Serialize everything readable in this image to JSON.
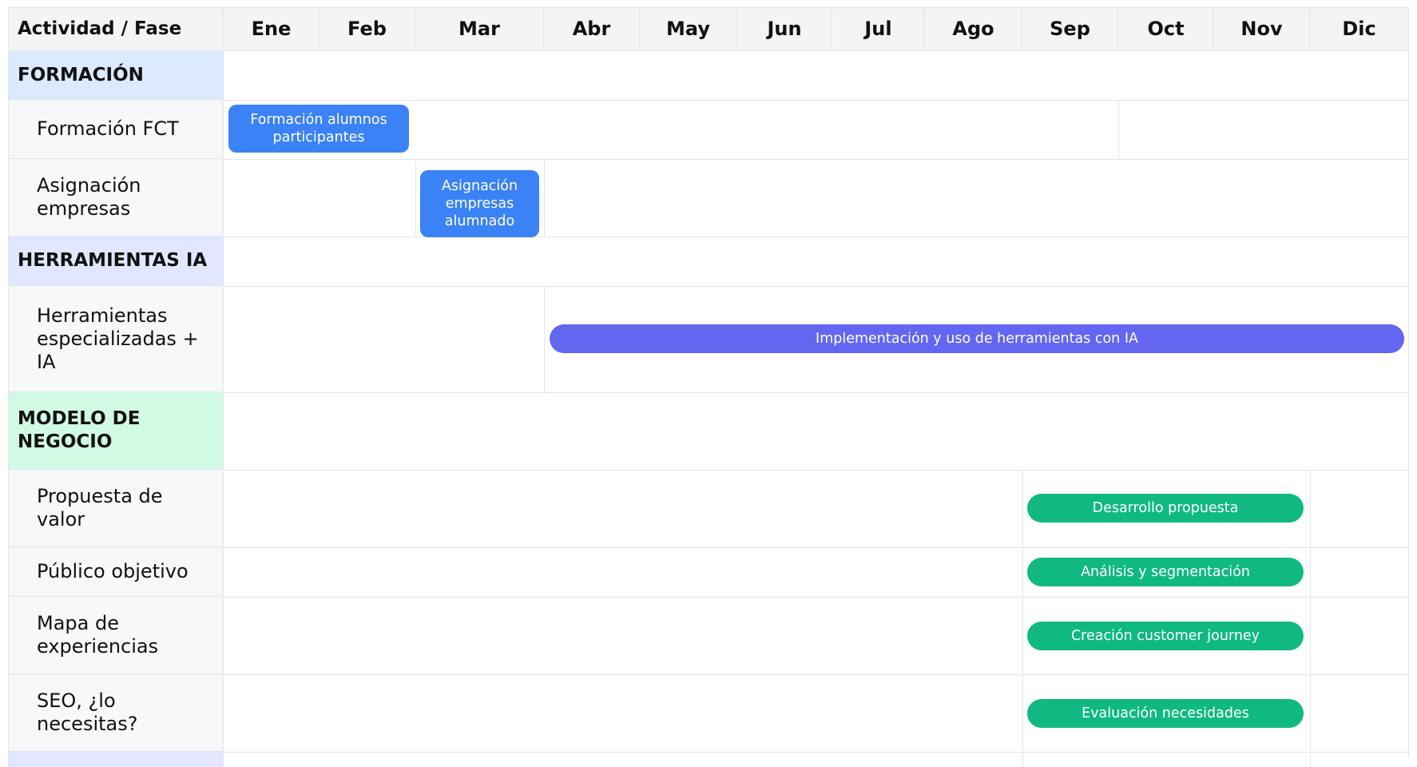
{
  "header": {
    "first_col": "Actividad / Fase",
    "months": [
      "Ene",
      "Feb",
      "Mar",
      "Abr",
      "May",
      "Jun",
      "Jul",
      "Ago",
      "Sep",
      "Oct",
      "Nov",
      "Dic"
    ]
  },
  "sections": {
    "formacion": {
      "label": "FORMACIÓN",
      "color": "#dbeafe"
    },
    "herramientas": {
      "label": "HERRAMIENTAS IA",
      "color": "#e0e7ff"
    },
    "modelo": {
      "label": "MODELO DE NEGOCIO",
      "color": "#d1fae5"
    }
  },
  "activities": {
    "formacion_fct": {
      "label": "Formación FCT",
      "bar": "Formación alumnos participantes"
    },
    "asignacion": {
      "label": "Asignación empresas",
      "bar": "Asignación empresas alumnado"
    },
    "herramientas_esp": {
      "label": "Herramientas especializadas + IA",
      "bar": "Implementación y uso de herramientas con IA"
    },
    "propuesta": {
      "label": "Propuesta de valor",
      "bar": "Desarrollo propuesta"
    },
    "publico": {
      "label": "Público objetivo",
      "bar": "Análisis y segmentación"
    },
    "mapa": {
      "label": "Mapa de experiencias",
      "bar": "Creación customer journey"
    },
    "seo": {
      "label": "SEO, ¿lo necesitas?",
      "bar": "Evaluación necesidades"
    }
  },
  "colors": {
    "formacion_bar": "#3b82f6",
    "herramientas_bar": "#6366f1",
    "modelo_bar": "#10b981",
    "grid_line": "#e2e4e8",
    "header_bg": "#f3f4f6"
  }
}
